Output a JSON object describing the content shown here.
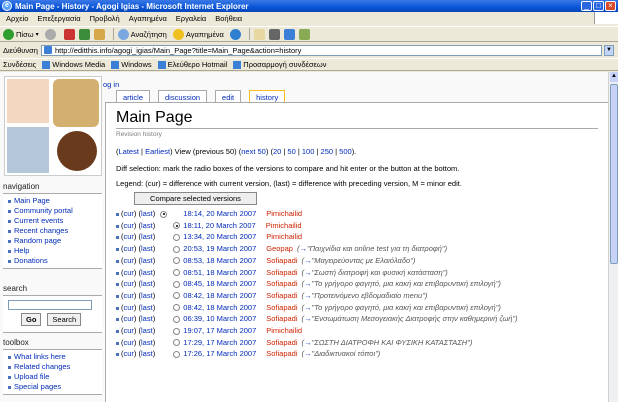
{
  "window": {
    "title": "Main Page - History - Agogi Igias - Microsoft Internet Explorer"
  },
  "menu": [
    "Αρχείο",
    "Επεξεργασία",
    "Προβολή",
    "Αγαπημένα",
    "Εργαλεία",
    "Βοήθεια"
  ],
  "toolbar": {
    "back": "Πίσω",
    "search": "Αναζήτηση",
    "favorites": "Αγαπημένα"
  },
  "address": {
    "label": "Διεύθυνση",
    "url": "http://editthis.info/agogi_igias/Main_Page?title=Main_Page&action=history"
  },
  "links": {
    "label": "Συνδέσεις",
    "items": [
      "Windows Media",
      "Windows",
      "Ελεύθερο Hotmail",
      "Προσαρμογή συνδέσεων"
    ]
  },
  "login": "og in",
  "tabs": [
    "article",
    "discussion",
    "edit",
    "history"
  ],
  "sidebar": {
    "navigation_title": "navigation",
    "navigation": [
      "Main Page",
      "Community portal",
      "Current events",
      "Recent changes",
      "Random page",
      "Help",
      "Donations"
    ],
    "search_title": "search",
    "go": "Go",
    "search_btn": "Search",
    "toolbox_title": "toolbox",
    "toolbox": [
      "What links here",
      "Related changes",
      "Upload file",
      "Special pages"
    ]
  },
  "content": {
    "title": "Main Page",
    "subtitle": "Revision history",
    "nav": {
      "latest": "Latest",
      "earliest": "Earliest",
      "view": "View (previous 50)",
      "next": "next 50",
      "pages": [
        "20",
        "50",
        "100",
        "250",
        "500"
      ]
    },
    "diff_info": "Diff selection: mark the radio boxes of the versions to compare and hit enter or the button at the bottom.",
    "legend": "Legend: (cur) = difference with current version, (last) = difference with preceding version, M = minor edit.",
    "compare_button": "Compare selected versions",
    "cur": "cur",
    "last": "last",
    "revisions": [
      {
        "date": "18:14, 20 March 2007",
        "user": "Pimichailid",
        "comment": "",
        "radio": "left"
      },
      {
        "date": "18:11, 20 March 2007",
        "user": "Pimichailid",
        "comment": "",
        "radio": "right"
      },
      {
        "date": "13:34, 20 March 2007",
        "user": "Pimichailid",
        "comment": "",
        "radio": "right"
      },
      {
        "date": "20:53, 19 March 2007",
        "user": "Geopap",
        "comment": "\"Παιχνίδια και online test για τη διατροφή\"",
        "radio": "right"
      },
      {
        "date": "08:53, 18 March 2007",
        "user": "Sofiapadi",
        "comment": "\"Μαγειρεύοντας με Ελαιόλαδο\"",
        "radio": "right"
      },
      {
        "date": "08:51, 18 March 2007",
        "user": "Sofiapadi",
        "comment": "\"Σωστή διατροφή και φυσική κατάσταση\"",
        "radio": "right"
      },
      {
        "date": "08:45, 18 March 2007",
        "user": "Sofiapadi",
        "comment": "\"Το γρήγορο φαγητό, μια κακή και επιβαρυντική επιλογή\"",
        "radio": "right"
      },
      {
        "date": "08:42, 18 March 2007",
        "user": "Sofiapadi",
        "comment": "\"Προτεινόμενο εβδομαδιαίο menu\"",
        "radio": "right"
      },
      {
        "date": "08:42, 18 March 2007",
        "user": "Sofiapadi",
        "comment": "\"Το γρήγορο φαγητό, μια κακή και επιβαρυντική επιλογή\"",
        "radio": "right"
      },
      {
        "date": "06:39, 10 March 2007",
        "user": "Sofiapadi",
        "comment": "\"Ενσωμάτωση Μεσογειακής Διατροφής στην καθημερινή ζωή\"",
        "radio": "right"
      },
      {
        "date": "19:07, 17 March 2007",
        "user": "Pimichailid",
        "comment": "",
        "radio": "right"
      },
      {
        "date": "17:29, 17 March 2007",
        "user": "Sofiapadi",
        "comment": "\"ΣΩΣΤΗ ΔΙΑΤΡΟΦΗ ΚΑΙ ΦΥΣΙΚΗ ΚΑΤΑΣΤΑΣΗ\"",
        "radio": "right"
      },
      {
        "date": "17:26, 17 March 2007",
        "user": "Sofiapadi",
        "comment": "\"Διαδικτυακοί τόποι\"",
        "radio": "right"
      }
    ]
  }
}
